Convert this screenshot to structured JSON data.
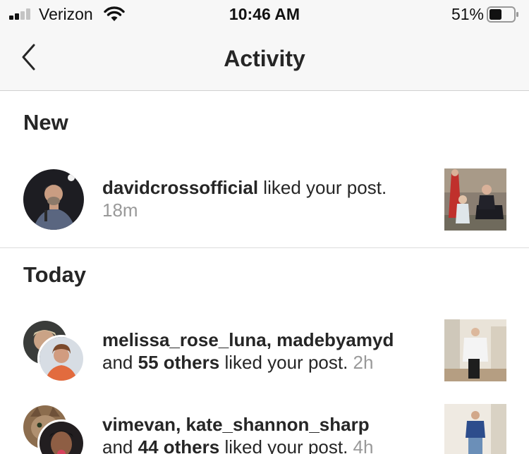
{
  "status_bar": {
    "carrier": "Verizon",
    "time": "10:46 AM",
    "battery_percent": "51%",
    "battery_level": 0.51,
    "signal_bars": 2,
    "icons": [
      "signal-icon",
      "wifi-icon",
      "battery-icon"
    ]
  },
  "nav": {
    "title": "Activity",
    "back_icon": "chevron-left-icon"
  },
  "sections": [
    {
      "header": "New",
      "items": [
        {
          "users": "davidcrossofficial",
          "action": " liked your post.",
          "time": "18m"
        }
      ]
    },
    {
      "header": "Today",
      "items": [
        {
          "users": "melissa_rose_luna, madebyamyd",
          "connector": "and ",
          "others": "55 others",
          "action": " liked your post.",
          "time": "2h"
        },
        {
          "users": "vimevan, kate_shannon_sharp",
          "connector": "and ",
          "others": "44 others",
          "action": " liked your post.",
          "time": "4h"
        }
      ]
    }
  ],
  "colors": {
    "bar_background": "#f7f7f7",
    "text": "#262626",
    "secondary_text": "#999999",
    "divider": "#dcdcdc"
  }
}
